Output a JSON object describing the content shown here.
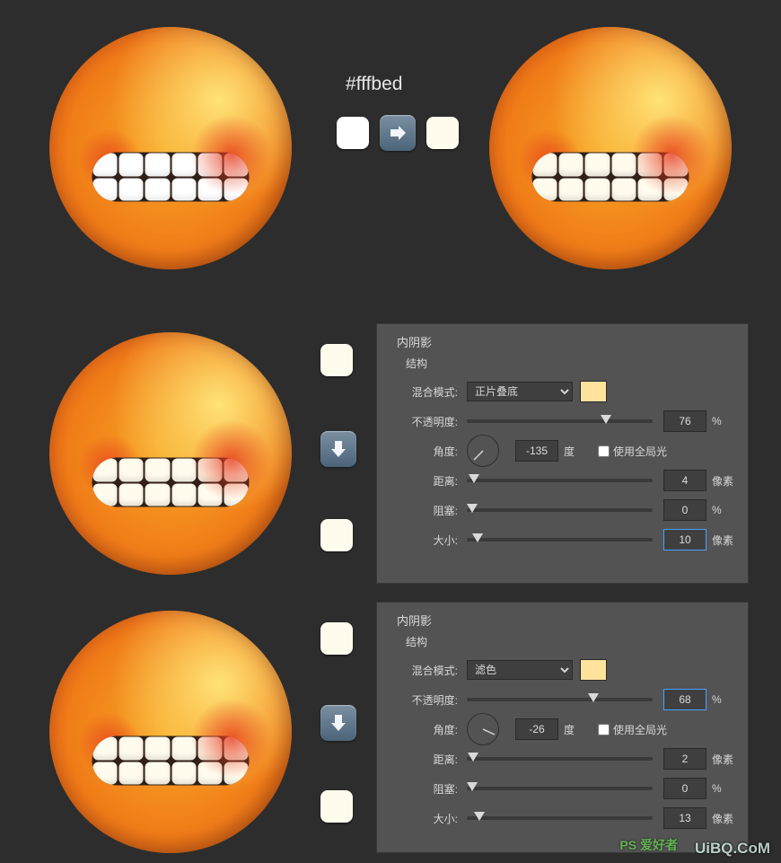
{
  "color_hex_label": "#fffbed",
  "swatch_colors": {
    "white": "#ffffff",
    "cream": "#fffbed"
  },
  "panel_common": {
    "title": "内阴影",
    "subtitle": "结构",
    "labels": {
      "blend_mode": "混合模式:",
      "opacity": "不透明度:",
      "angle": "角度:",
      "degree": "度",
      "use_global": "使用全局光",
      "distance": "距离:",
      "spread": "阻塞:",
      "size": "大小:",
      "px": "像素",
      "pct": "%"
    }
  },
  "panel1": {
    "blend_mode_value": "正片叠底",
    "opacity": "76",
    "angle": "-135",
    "use_global": false,
    "distance": "4",
    "spread": "0",
    "size": "10"
  },
  "panel2": {
    "blend_mode_value": "滤色",
    "opacity": "68",
    "angle": "-26",
    "use_global": false,
    "distance": "2",
    "spread": "0",
    "size": "13"
  },
  "watermark": {
    "site": "UiBQ.CoM",
    "ps": "PS 爱好者"
  }
}
